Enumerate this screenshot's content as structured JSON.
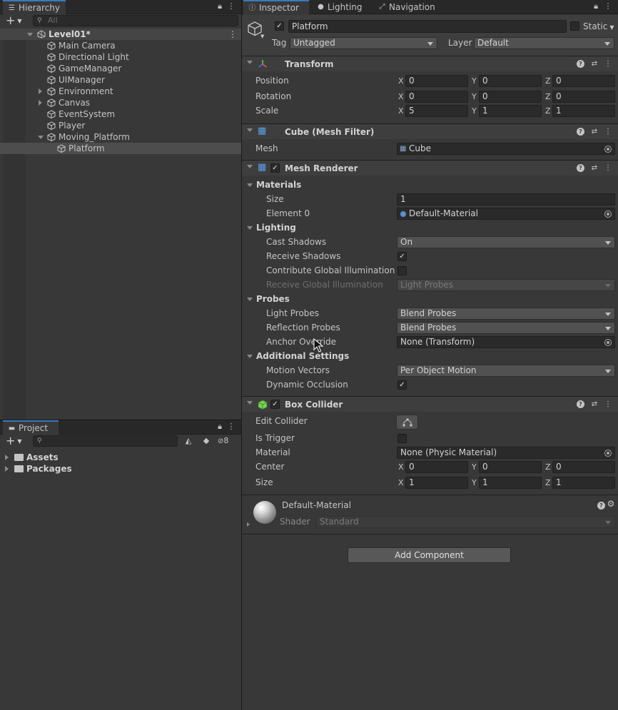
{
  "hierarchy": {
    "tab_label": "Hierarchy",
    "search_placeholder": "All",
    "scene": "Level01*",
    "items": [
      {
        "label": "Main Camera"
      },
      {
        "label": "Directional Light"
      },
      {
        "label": "GameManager"
      },
      {
        "label": "UIManager"
      },
      {
        "label": "Environment"
      },
      {
        "label": "Canvas"
      },
      {
        "label": "EventSystem"
      },
      {
        "label": "Player"
      },
      {
        "label": "Moving_Platform"
      },
      {
        "label": "Platform"
      }
    ]
  },
  "project": {
    "tab_label": "Project",
    "hidden_count": "8",
    "items": [
      {
        "label": "Assets"
      },
      {
        "label": "Packages"
      }
    ]
  },
  "inspector": {
    "tabs": [
      {
        "label": "Inspector"
      },
      {
        "label": "Lighting"
      },
      {
        "label": "Navigation"
      }
    ],
    "object_name": "Platform",
    "static_label": "Static",
    "tag_label": "Tag",
    "tag_value": "Untagged",
    "layer_label": "Layer",
    "layer_value": "Default",
    "transform": {
      "title": "Transform",
      "position_label": "Position",
      "rotation_label": "Rotation",
      "scale_label": "Scale",
      "x": "X",
      "y": "Y",
      "z": "Z",
      "position": [
        "0",
        "0",
        "0"
      ],
      "rotation": [
        "0",
        "0",
        "0"
      ],
      "scale": [
        "5",
        "1",
        "1"
      ]
    },
    "mesh_filter": {
      "title": "Cube (Mesh Filter)",
      "mesh_label": "Mesh",
      "mesh_value": "Cube"
    },
    "mesh_renderer": {
      "title": "Mesh Renderer",
      "materials_label": "Materials",
      "size_label": "Size",
      "size_value": "1",
      "element0_label": "Element 0",
      "element0_value": "Default-Material",
      "lighting_label": "Lighting",
      "cast_shadows_label": "Cast Shadows",
      "cast_shadows_value": "On",
      "receive_shadows_label": "Receive Shadows",
      "contribute_gi_label": "Contribute Global Illumination",
      "receive_gi_label": "Receive Global Illumination",
      "receive_gi_value": "Light Probes",
      "probes_label": "Probes",
      "light_probes_label": "Light Probes",
      "light_probes_value": "Blend Probes",
      "reflection_probes_label": "Reflection Probes",
      "reflection_probes_value": "Blend Probes",
      "anchor_override_label": "Anchor Override",
      "anchor_override_value": "None (Transform)",
      "additional_label": "Additional Settings",
      "motion_vectors_label": "Motion Vectors",
      "motion_vectors_value": "Per Object Motion",
      "dynamic_occlusion_label": "Dynamic Occlusion"
    },
    "box_collider": {
      "title": "Box Collider",
      "edit_collider_label": "Edit Collider",
      "is_trigger_label": "Is Trigger",
      "material_label": "Material",
      "material_value": "None (Physic Material)",
      "center_label": "Center",
      "size_label": "Size",
      "center": [
        "0",
        "0",
        "0"
      ],
      "size": [
        "1",
        "1",
        "1"
      ]
    },
    "material": {
      "name": "Default-Material",
      "shader_label": "Shader",
      "shader_value": "Standard"
    },
    "add_component": "Add Component"
  },
  "colors": {
    "panel_bg": "#383838",
    "selection": "#4d4d4d",
    "accent_tab": "#3a79bb",
    "field_bg": "#2a2a2a"
  }
}
